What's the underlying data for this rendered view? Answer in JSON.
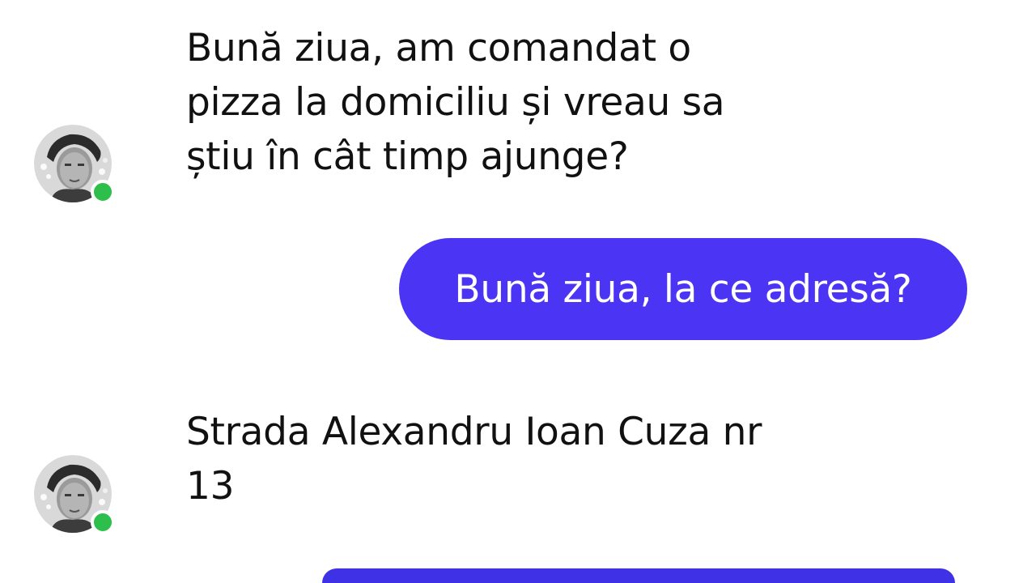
{
  "colors": {
    "bubble_outgoing": "#4B34F3",
    "bubble_outgoing_partial": "#3F32E6",
    "online_indicator": "#2DBE4B",
    "text_incoming": "#111111",
    "text_outgoing": "#FFFFFF",
    "background": "#FFFFFF"
  },
  "messages": [
    {
      "sender": "contact",
      "avatar_icon": "contact-avatar-photo",
      "online": true,
      "text": "Bună ziua, am comandat o\npizza la domiciliu și vreau sa\nștiu în cât timp ajunge?"
    },
    {
      "sender": "me",
      "text": "Bună ziua, la ce adresă?"
    },
    {
      "sender": "contact",
      "avatar_icon": "contact-avatar-photo",
      "online": true,
      "text": "Strada Alexandru Ioan Cuza nr\n13"
    },
    {
      "sender": "me",
      "text": ""
    }
  ]
}
